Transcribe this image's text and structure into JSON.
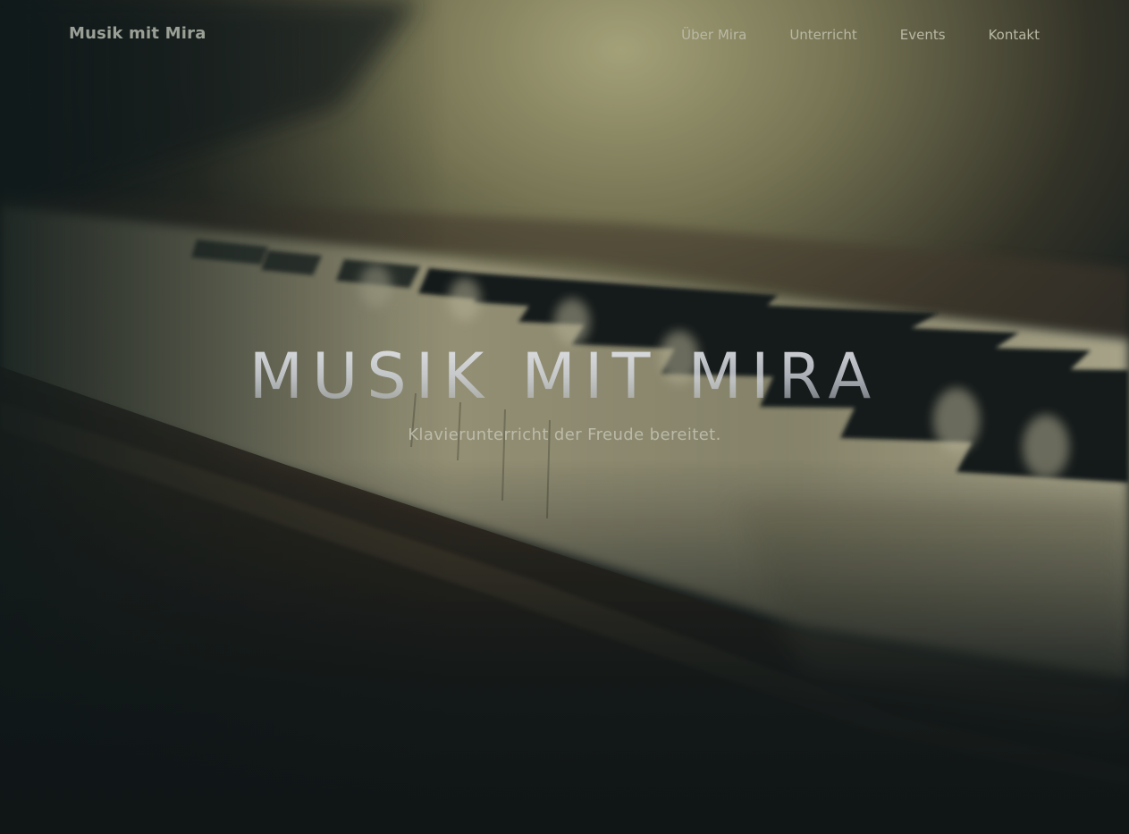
{
  "header": {
    "brand": "Musik mit Mira",
    "nav": [
      {
        "label": "Über Mira"
      },
      {
        "label": "Unterricht"
      },
      {
        "label": "Events"
      },
      {
        "label": "Kontakt"
      }
    ]
  },
  "hero": {
    "title": "MUSIK MIT MIRA",
    "subtitle": "Klavierunterricht der Freude bereitet."
  },
  "background": {
    "subject": "piano-keys-photo",
    "colors": {
      "glow": "#b7b383",
      "dark": "#121a1b",
      "wood": "#3b3023",
      "key_white": "#d8d2b4"
    }
  }
}
